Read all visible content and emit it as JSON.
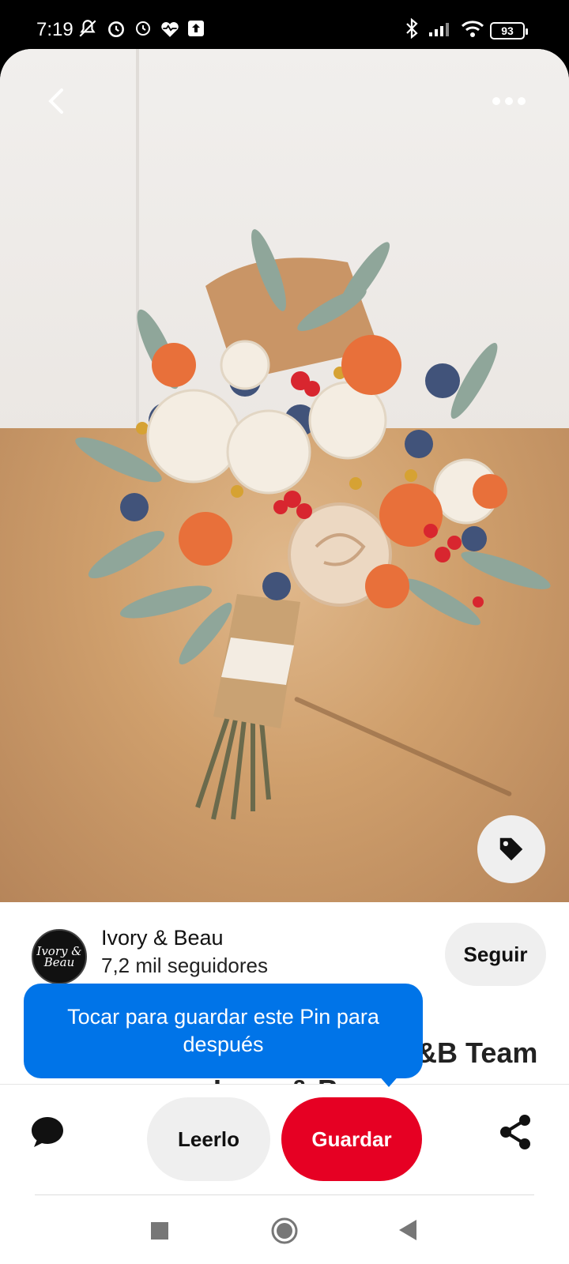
{
  "status_bar": {
    "time": "7:19",
    "battery": "93",
    "icons": [
      "mute-icon",
      "alarm-icon",
      "clock-icon",
      "heart-monitor-icon",
      "upload-icon",
      "bluetooth-icon",
      "signal-icon",
      "wifi-icon",
      "battery-icon"
    ]
  },
  "pin": {
    "image_icons": [
      "back-arrow-icon",
      "more-options-icon",
      "tag-icon"
    ]
  },
  "creator": {
    "avatar_text": "Ivory & Beau",
    "name": "Ivory & Beau",
    "followers": "7,2 mil seguidores",
    "follow_label": "Seguir"
  },
  "partial_title": "&B Team",
  "partial_title_line2": "Ivory & Beau",
  "tooltip": {
    "text": "Tocar para guardar este Pin para después"
  },
  "actions": {
    "read_label": "Leerlo",
    "save_label": "Guardar",
    "comment_icon": "comment-icon",
    "share_icon": "share-icon"
  },
  "colors": {
    "save_button": "#e60023",
    "tooltip": "#0074e8",
    "secondary_button": "#efefef"
  }
}
